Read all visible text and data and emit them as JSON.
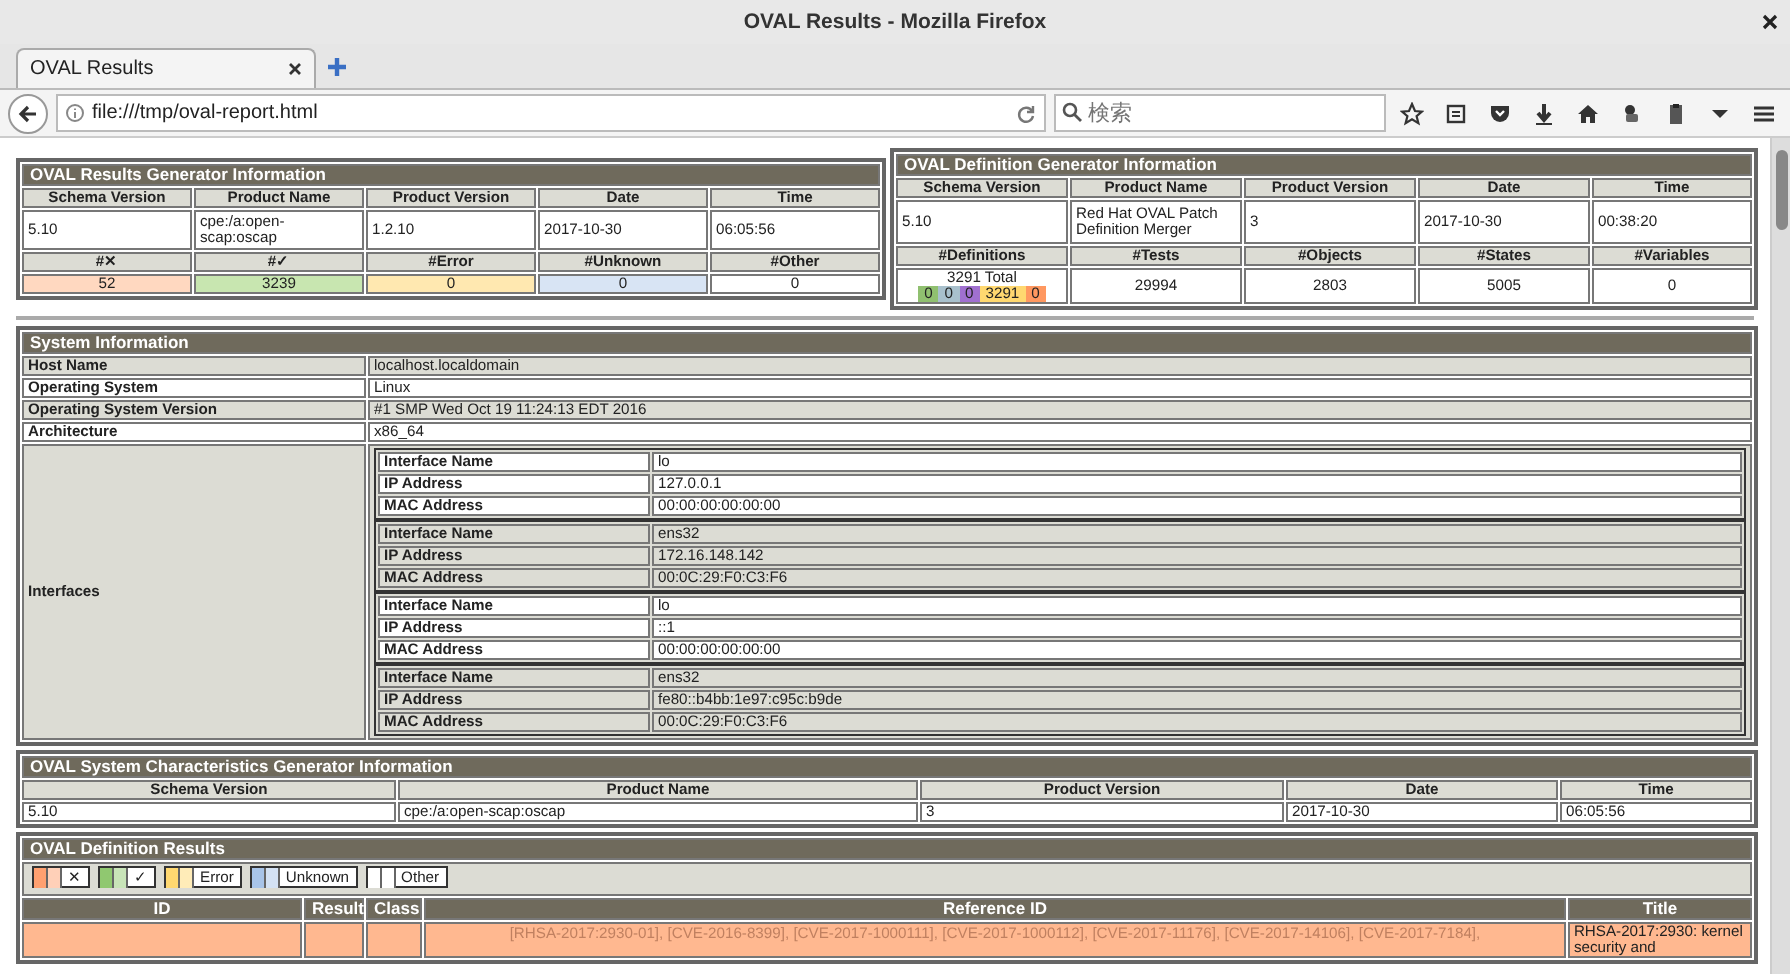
{
  "window": {
    "title": "OVAL Results - Mozilla Firefox"
  },
  "browser": {
    "tab": {
      "label": "OVAL Results",
      "selected": true
    },
    "url": "file:///tmp/oval-report.html",
    "search": {
      "placeholder": "検索"
    }
  },
  "results_generator": {
    "title": "OVAL Results Generator Information",
    "columns": [
      "Schema Version",
      "Product Name",
      "Product Version",
      "Date",
      "Time"
    ],
    "values": [
      "5.10",
      "cpe:/a:open-scap:oscap",
      "1.2.10",
      "2017-10-30",
      "06:05:56"
    ],
    "count_columns": [
      "#✕",
      "#✓",
      "#Error",
      "#Unknown",
      "#Other"
    ],
    "counts": [
      {
        "value": "52",
        "color": "#ffd8c0"
      },
      {
        "value": "3239",
        "color": "#c8e6b0"
      },
      {
        "value": "0",
        "color": "#ffe8b0"
      },
      {
        "value": "0",
        "color": "#d8e4f4"
      },
      {
        "value": "0",
        "color": "#ffffff"
      }
    ]
  },
  "definition_generator": {
    "title": "OVAL Definition Generator Information",
    "columns": [
      "Schema Version",
      "Product Name",
      "Product Version",
      "Date",
      "Time"
    ],
    "values": [
      "5.10",
      "Red Hat OVAL Patch Definition Merger",
      "3",
      "2017-10-30",
      "00:38:20"
    ],
    "count_columns": [
      "#Definitions",
      "#Tests",
      "#Objects",
      "#States",
      "#Variables"
    ],
    "definitions_total": "3291 Total",
    "definitions_breakdown": [
      {
        "value": "0",
        "color": "#90c070"
      },
      {
        "value": "0",
        "color": "#a8c0cc"
      },
      {
        "value": "0",
        "color": "#a070d0"
      },
      {
        "value": "3291",
        "color": "#ffd870"
      },
      {
        "value": "0",
        "color": "#ff9860"
      }
    ],
    "counts": [
      "29994",
      "2803",
      "5005",
      "0"
    ]
  },
  "system_information": {
    "title": "System Information",
    "rows": [
      {
        "label": "Host Name",
        "value": "localhost.localdomain"
      },
      {
        "label": "Operating System",
        "value": "Linux"
      },
      {
        "label": "Operating System Version",
        "value": "#1 SMP Wed Oct 19 11:24:13 EDT 2016"
      },
      {
        "label": "Architecture",
        "value": "x86_64"
      }
    ],
    "interfaces_label": "Interfaces",
    "interfaces": [
      {
        "rows": [
          {
            "label": "Interface Name",
            "value": "lo"
          },
          {
            "label": "IP Address",
            "value": "127.0.0.1"
          },
          {
            "label": "MAC Address",
            "value": "00:00:00:00:00:00"
          }
        ]
      },
      {
        "rows": [
          {
            "label": "Interface Name",
            "value": "ens32"
          },
          {
            "label": "IP Address",
            "value": "172.16.148.142"
          },
          {
            "label": "MAC Address",
            "value": "00:0C:29:F0:C3:F6"
          }
        ]
      },
      {
        "rows": [
          {
            "label": "Interface Name",
            "value": "lo"
          },
          {
            "label": "IP Address",
            "value": "::1"
          },
          {
            "label": "MAC Address",
            "value": "00:00:00:00:00:00"
          }
        ]
      },
      {
        "rows": [
          {
            "label": "Interface Name",
            "value": "ens32"
          },
          {
            "label": "IP Address",
            "value": "fe80::b4bb:1e97:c95c:b9de"
          },
          {
            "label": "MAC Address",
            "value": "00:0C:29:F0:C3:F6"
          }
        ]
      }
    ]
  },
  "system_characteristics_generator": {
    "title": "OVAL System Characteristics Generator Information",
    "columns": [
      "Schema Version",
      "Product Name",
      "Product Version",
      "Date",
      "Time"
    ],
    "values": [
      "5.10",
      "cpe:/a:open-scap:oscap",
      "3",
      "2017-10-30",
      "06:05:56"
    ]
  },
  "definition_results": {
    "title": "OVAL Definition Results",
    "legend": [
      {
        "label": "✕",
        "color": "#ffa070"
      },
      {
        "label": "✓",
        "color": "#90c870"
      },
      {
        "label": "Error",
        "color": "#ffd870"
      },
      {
        "label": "Unknown",
        "color": "#a8c4e8"
      },
      {
        "label": "Other",
        "color": "#ffffff"
      }
    ],
    "columns": [
      "ID",
      "Result",
      "Class",
      "Reference ID",
      "Title"
    ],
    "rows": [
      {
        "color": "#ffb890",
        "references": [
          "[RHSA-2017:2930-01],",
          "[CVE-2016-8399],",
          "[CVE-2017-1000111],",
          "[CVE-2017-1000112],",
          "[CVE-2017-11176],",
          "[CVE-2017-14106],",
          "[CVE-2017-7184],"
        ],
        "title": "RHSA-2017:2930: kernel security and"
      }
    ]
  }
}
